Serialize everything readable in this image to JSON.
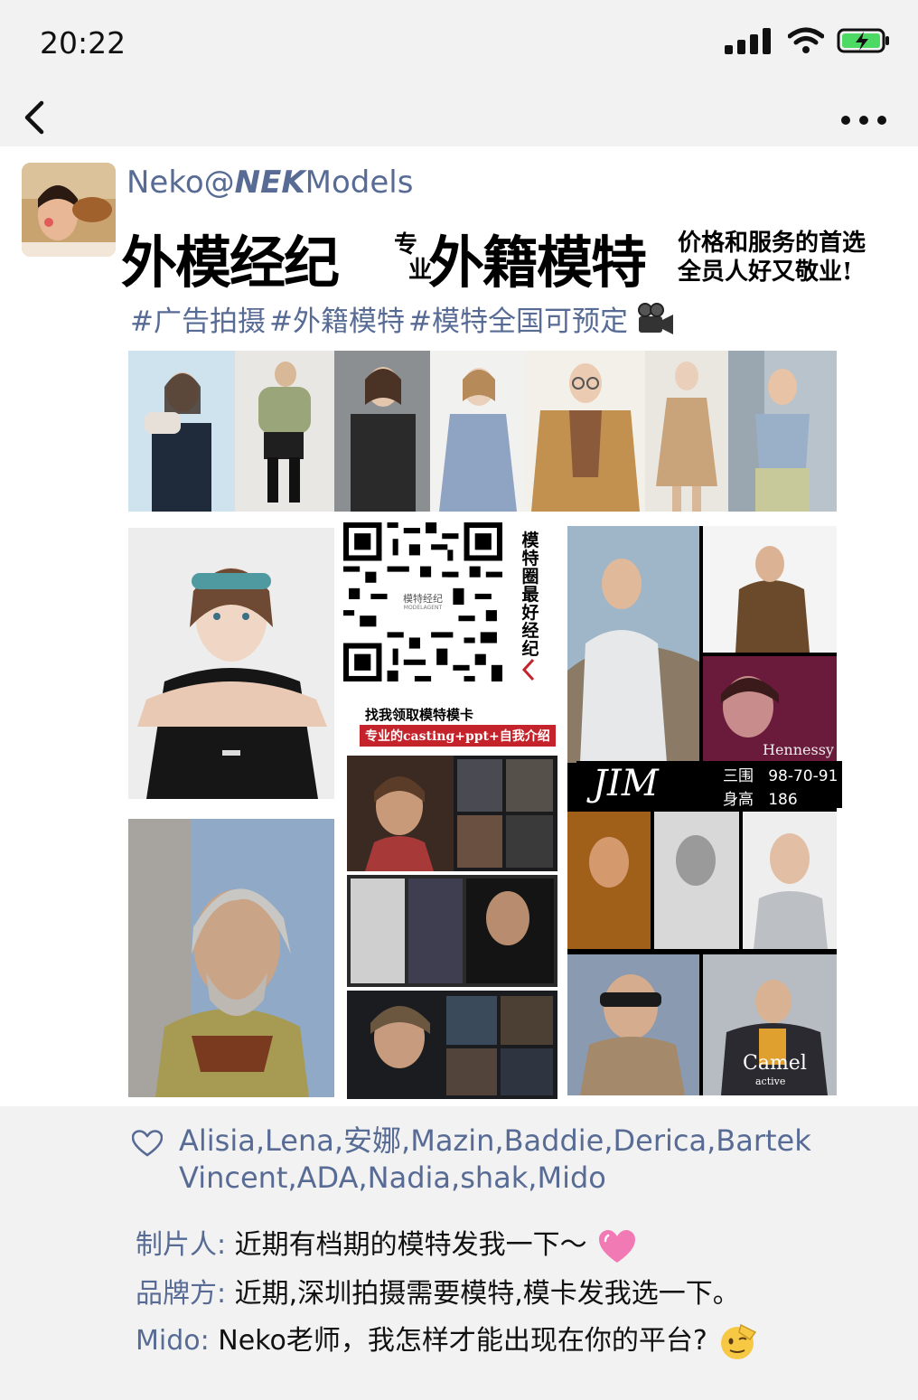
{
  "status_bar": {
    "time": "20:22",
    "icons": [
      "signal-icon",
      "wifi-icon",
      "battery-charging-icon"
    ]
  },
  "nav": {
    "back_icon": "chevron-left-icon",
    "more_icon": "more-dots-icon"
  },
  "post": {
    "author_prefix": "Neko@",
    "author_brand": "NEK",
    "author_suffix": "Models",
    "hero": {
      "big_1": "外模经纪",
      "mid_1": "专",
      "mid_2": "业",
      "big_2": "外籍模特",
      "right_1": "价格和服务的首选",
      "right_2": "全员人好又敬业!"
    },
    "tags": [
      "#广告拍摄",
      "#外籍模特",
      "#模特全国可预定"
    ],
    "tag_icon": "movie-camera-icon",
    "poster": {
      "qr_center_label": "模特经纪",
      "qr_center_sub": "MODELAGENT",
      "side_text": "模特圈最好经纪",
      "cta": "找我领取模特模卡",
      "cta_sub": "专业的casting+ppt+自我介绍",
      "jim_name": "JIM",
      "jim_stats": [
        {
          "label": "三围",
          "value": "98-70-91"
        },
        {
          "label": "身高",
          "value": "186"
        }
      ],
      "hennessy": "Hennessy",
      "camel": "Camel",
      "camel_sub": "active"
    }
  },
  "likes": {
    "icon": "heart-icon",
    "names": "Alisia,Lena,安娜,Mazin,Baddie,Derica,Bartek Vincent,ADA,Nadia,shak,Mido"
  },
  "comments": [
    {
      "author": "制片人:",
      "text": "近期有档期的模特发我一下～",
      "emoji": "sparkling-heart-emoji"
    },
    {
      "author": "品牌方:",
      "text": "近期,深圳拍摄需要模特,模卡发我选一下。",
      "emoji": ""
    },
    {
      "author": "Mido:",
      "text": "Neko老师，我怎样才能出现在你的平台?",
      "emoji": "saluting-face-emoji"
    }
  ]
}
